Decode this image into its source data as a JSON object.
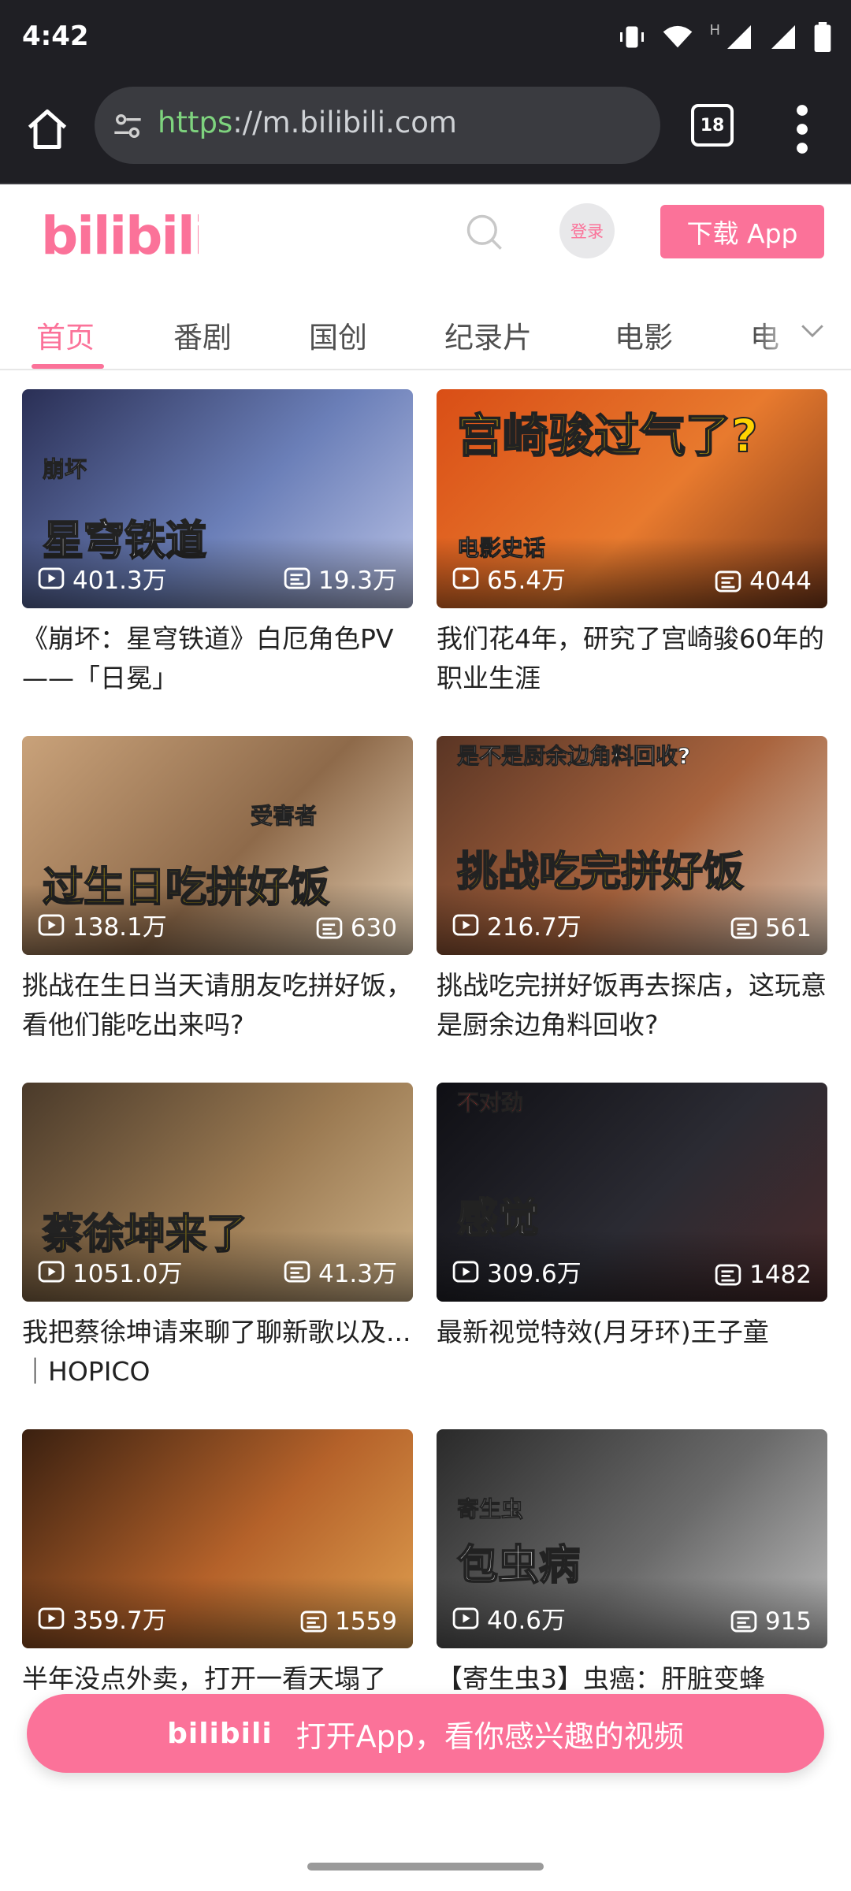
{
  "status_bar": {
    "time": "4:42",
    "network_label": "H"
  },
  "browser": {
    "url_scheme": "https",
    "url_rest": "://m.bilibili.com",
    "tab_count": "18"
  },
  "header": {
    "login_label": "登录",
    "download_label": "下载 App"
  },
  "categories": [
    "首页",
    "番剧",
    "国创",
    "纪录片",
    "电影",
    "电"
  ],
  "videos": [
    {
      "title": "《崩坏：星穹铁道》白厄角色PV——「日冕」",
      "plays": "401.3万",
      "danmaku": "19.3万",
      "overlay": "星穹铁道",
      "overlay_small": "崩坏",
      "colors": [
        "#2a2f55",
        "#6b7fb8",
        "#b9c2e6"
      ]
    },
    {
      "title": "我们花4年，研究了宫崎骏60年的职业生涯",
      "plays": "65.4万",
      "danmaku": "4044",
      "overlay": "宫崎骏过气了?",
      "overlay_small": "电影史话",
      "colors": [
        "#d94e16",
        "#e87a2e",
        "#7a3a1a"
      ]
    },
    {
      "title": "挑战在生日当天请朋友吃拼好饭，看他们能吃出来吗?",
      "plays": "138.1万",
      "danmaku": "630",
      "overlay": "过生日吃拼好饭",
      "overlay_small": "受害者",
      "colors": [
        "#c9a27a",
        "#8e6a4a",
        "#e8d2b5"
      ]
    },
    {
      "title": "挑战吃完拼好饭再去探店，这玩意是厨余边角料回收?",
      "plays": "216.7万",
      "danmaku": "561",
      "overlay": "挑战吃完拼好饭",
      "overlay_small": "是不是厨余边角料回收?",
      "colors": [
        "#5a3524",
        "#a9643e",
        "#d8c3b0"
      ]
    },
    {
      "title": "我把蔡徐坤请来聊了聊新歌以及...｜HOPICO",
      "plays": "1051.0万",
      "danmaku": "41.3万",
      "overlay": "蔡徐坤来了",
      "overlay_small": "",
      "colors": [
        "#4a3a2a",
        "#9b7a52",
        "#d0b48a"
      ]
    },
    {
      "title": "最新视觉特效(月牙环)王子童",
      "plays": "309.6万",
      "danmaku": "1482",
      "overlay": "感觉",
      "overlay_small": "不对劲",
      "colors": [
        "#0f0f14",
        "#2b2b33",
        "#4a2a2a"
      ]
    },
    {
      "title": "半年没点外卖，打开一看天塌了",
      "plays": "359.7万",
      "danmaku": "1559",
      "overlay": "",
      "overlay_small": "",
      "colors": [
        "#3a2010",
        "#b5622a",
        "#e0a050"
      ]
    },
    {
      "title": "【寄生虫3】虫癌：肝脏变蜂",
      "plays": "40.6万",
      "danmaku": "915",
      "overlay": "包虫病",
      "overlay_small": "寄生虫",
      "colors": [
        "#2a2a2a",
        "#6a6a6a",
        "#bdbdbd"
      ]
    }
  ],
  "open_app_banner": {
    "logo_text": "bilibili",
    "text": "打开App，看你感兴趣的视频"
  },
  "theme": {
    "accent": "#fb7299"
  }
}
